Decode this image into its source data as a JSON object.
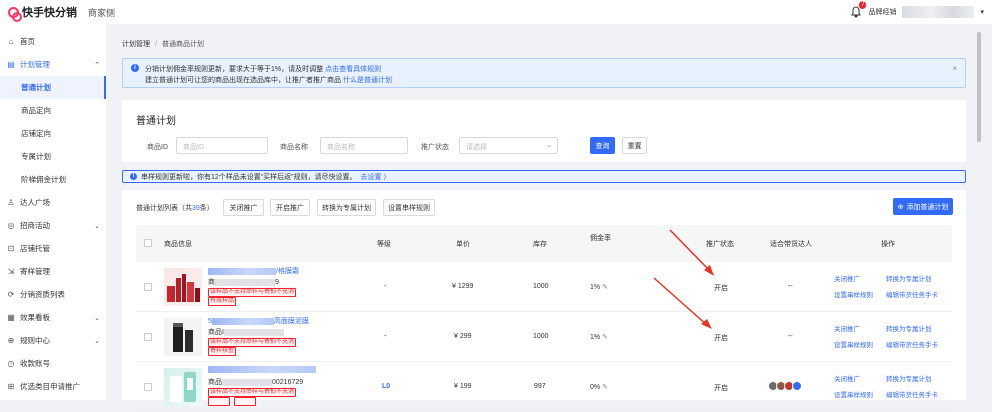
{
  "app": {
    "title": "快手快分销",
    "subtitle": "商家侧"
  },
  "topbar": {
    "notify_count": "7",
    "role": "品牌经销"
  },
  "sidebar": {
    "items": [
      {
        "label": "首页",
        "icon": "home-icon"
      },
      {
        "label": "计划管理",
        "icon": "plan-icon",
        "open": true
      },
      {
        "label": "达人广场",
        "icon": "user-icon"
      },
      {
        "label": "招商活动",
        "icon": "campaign-icon"
      },
      {
        "label": "店铺托管",
        "icon": "store-icon"
      },
      {
        "label": "寄样管理",
        "icon": "sample-icon"
      },
      {
        "label": "分销资质列表",
        "icon": "qualification-icon"
      },
      {
        "label": "效果看板",
        "icon": "dashboard-icon"
      },
      {
        "label": "规则中心",
        "icon": "rules-icon"
      },
      {
        "label": "收款账号",
        "icon": "account-icon"
      },
      {
        "label": "优选类目申请推广",
        "icon": "category-icon"
      }
    ],
    "sub_items": [
      {
        "label": "普通计划",
        "active": true
      },
      {
        "label": "商品定向"
      },
      {
        "label": "店铺定向"
      },
      {
        "label": "专属计划"
      },
      {
        "label": "阶梯佣金计划"
      }
    ]
  },
  "breadcrumb": {
    "root": "计划管理",
    "sep": "/",
    "current": "普通商品计划"
  },
  "notice": {
    "line1": "分销计划佣金率规则更新，要求大于等于1%，请及时调整",
    "line1_link": "点击查看具体规则",
    "line2": "建立普通计划可让您的商品出现在选品库中，让推广者推广商品",
    "line2_link": "什么是普通计划"
  },
  "page_title": "普通计划",
  "filters": {
    "product_id_label": "商品ID",
    "product_id_placeholder": "商品ID",
    "product_name_label": "商品名称",
    "product_name_placeholder": "商品名称",
    "status_label": "推广状态",
    "status_placeholder": "请选择",
    "query": "查询",
    "reset": "重置"
  },
  "warning": {
    "text": "串样规则更新啦，你有12个样品未设置“买样后返”规则，请尽快设置。",
    "link": "去设置 〉"
  },
  "list": {
    "title_prefix": "普通计划列表（共",
    "count": "39",
    "title_suffix": "条）",
    "btn_close": "关闭推广",
    "btn_open": "开启推广",
    "btn_convert": "转换为专属计划",
    "btn_sample": "设置串样规则",
    "btn_add": "添加普通计划"
  },
  "table": {
    "headers": [
      "商品信息",
      "等级",
      "单价",
      "库存",
      "佣金率",
      "推广状态",
      "适合带货达人",
      "操作"
    ],
    "rows": [
      {
        "name_suffix": "/格膜霜",
        "id_prefix": "商",
        "id_suffix": "9",
        "tags": [
          "该样品不支持串样与寄拍不充消",
          "有效样品"
        ],
        "level": "-",
        "price": "¥ 1299",
        "stock": "1000",
        "rate": "1%",
        "status": "开启",
        "kol": "--",
        "actions": [
          "关闭推广",
          "转换为专属计划",
          "设置串样规则",
          "编辑带货任务手卡"
        ]
      },
      {
        "name_prefix": "5",
        "name_suffix": "高面膜泥膜",
        "id_prefix": "商品I",
        "tags": [
          "该样品不支持串样与寄拍不充消",
          "寄样核查"
        ],
        "level": "-",
        "price": "¥ 299",
        "stock": "1000",
        "rate": "1%",
        "status": "开启",
        "kol": "--",
        "actions": [
          "关闭推广",
          "转换为专属计划",
          "设置串样规则",
          "编辑带货任务手卡"
        ]
      },
      {
        "id_prefix": "商品",
        "id_suffix": "00216729",
        "tags": [
          "该样品不支持串样与寄拍不充消",
          "",
          ""
        ],
        "level": "L0",
        "price": "¥ 199",
        "stock": "997",
        "rate": "0%",
        "status": "开启",
        "kol": "",
        "actions": [
          "关闭推广",
          "转换为专属计划",
          "设置串样规则",
          "编辑带货任务手卡"
        ]
      }
    ]
  },
  "colors": {
    "accent": "#326bfb",
    "danger": "#f5222d",
    "arrow": "#e8331f"
  }
}
